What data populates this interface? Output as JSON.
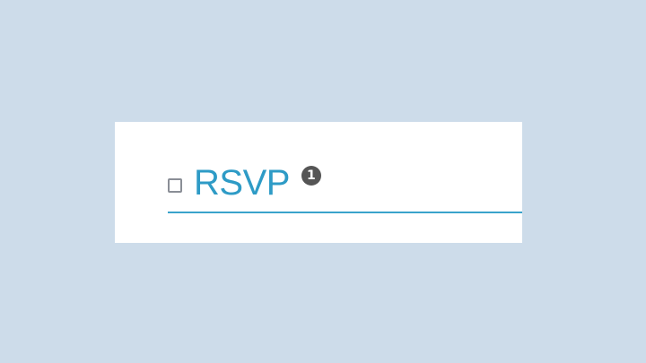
{
  "tab": {
    "label": "RSVP",
    "badge_count": "1",
    "checked": false
  },
  "colors": {
    "background": "#cddcea",
    "accent": "#2e9bc6",
    "badge": "#555555"
  },
  "icons": {
    "checkbox": "checkbox-unchecked-icon"
  }
}
